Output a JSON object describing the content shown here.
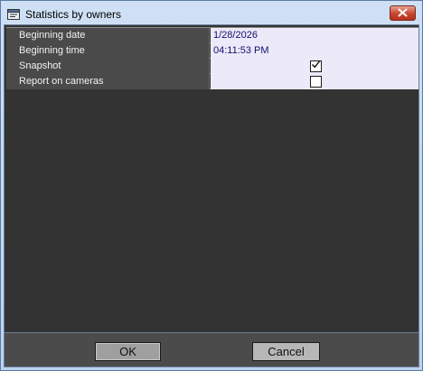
{
  "window": {
    "title": "Statistics by owners",
    "icon": "report-window-icon",
    "close_icon": "close-icon"
  },
  "properties": [
    {
      "label": "Beginning date",
      "type": "text",
      "value": "1/28/2026"
    },
    {
      "label": "Beginning time",
      "type": "text",
      "value": "04:11:53 PM"
    },
    {
      "label": "Snapshot",
      "type": "checkbox",
      "checked": true
    },
    {
      "label": "Report on cameras",
      "type": "checkbox",
      "checked": false
    }
  ],
  "buttons": {
    "ok_label": "OK",
    "cancel_label": "Cancel"
  },
  "colors": {
    "value_cell_bg": "#ece9f8",
    "value_text": "#101070",
    "client_bg": "#333333",
    "close_button": "#c8452f"
  }
}
